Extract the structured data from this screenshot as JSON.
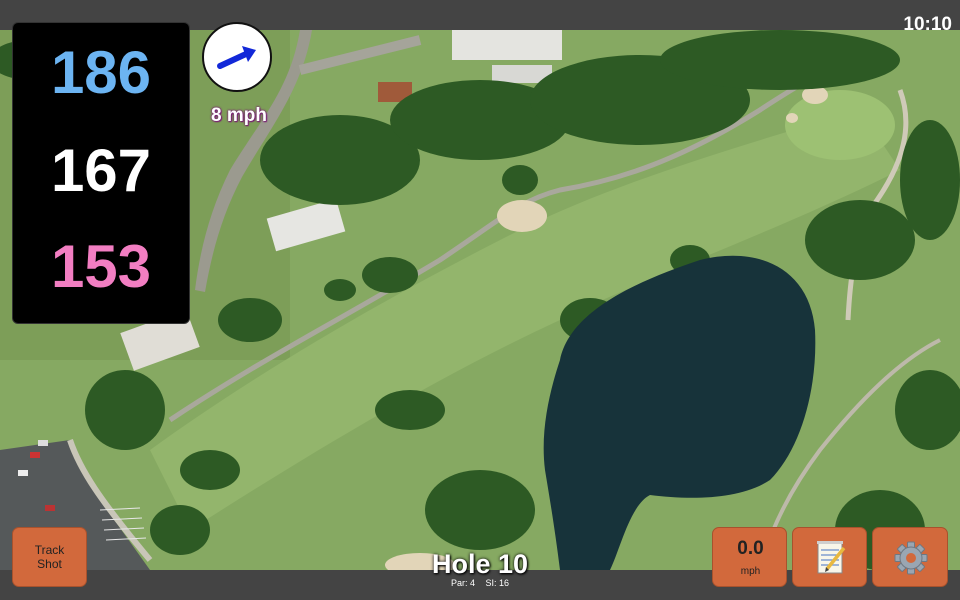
{
  "status": {
    "time": "10:10"
  },
  "yardages": {
    "back": "186",
    "middle": "167",
    "front": "153"
  },
  "wind": {
    "speed_label": "8 mph"
  },
  "buttons": {
    "track_shot_line1": "Track",
    "track_shot_line2": "Shot",
    "speed_value": "0.0",
    "speed_unit": "mph"
  },
  "hole": {
    "title": "Hole 10",
    "par": "Par: 4",
    "stroke_index": "SI: 16"
  },
  "icons": {
    "wind_arrow": "arrow-icon",
    "notes": "notepad-icon",
    "settings": "gear-icon"
  },
  "colors": {
    "back": "#6cb4f2",
    "middle": "#ffffff",
    "front": "#f27ec2",
    "button": "#d2693c",
    "wind_text_outline": "#7a1c74"
  }
}
